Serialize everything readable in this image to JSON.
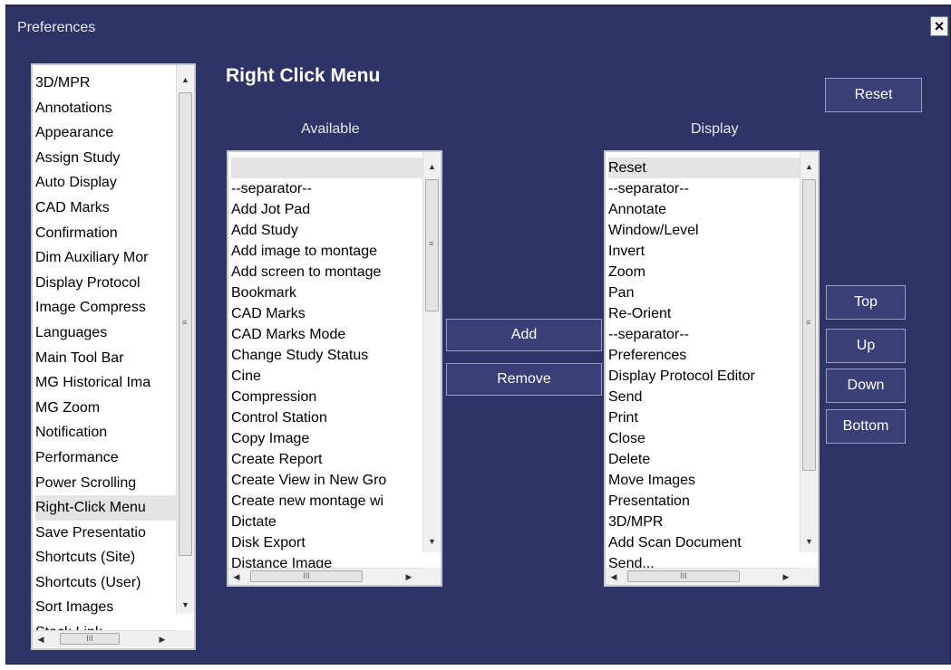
{
  "window": {
    "title": "Preferences",
    "close_label": "×"
  },
  "heading": "Right Click Menu",
  "reset_label": "Reset",
  "available_label": "Available",
  "display_label": "Display",
  "add_label": "Add",
  "remove_label": "Remove",
  "top_label": "Top",
  "up_label": "Up",
  "down_label": "Down",
  "bottom_label": "Bottom",
  "category_list": {
    "items": [
      "3D/MPR",
      "Annotations",
      "Appearance",
      "Assign Study",
      "Auto Display",
      "CAD Marks",
      "Confirmation",
      "Dim Auxiliary Mor",
      "Display Protocol",
      "Image Compress",
      "Languages",
      "Main Tool Bar",
      "MG Historical Ima",
      "MG Zoom",
      "Notification",
      "Performance",
      "Power Scrolling",
      "Right-Click Menu",
      "Save Presentatio",
      "Shortcuts (Site)",
      "Shortcuts (User)",
      "Sort Images",
      "Stack Link"
    ],
    "selected": "Right-Click Menu"
  },
  "available_list": {
    "items": [
      "",
      "--separator--",
      "Add Jot Pad",
      "Add Study",
      "Add image to montage",
      "Add screen to montage",
      "Bookmark",
      "CAD Marks",
      "CAD Marks Mode",
      "Change Study Status",
      "Cine",
      "Compression",
      "Control Station",
      "Copy Image",
      "Create Report",
      "Create View in New Gro",
      "Create new montage wi",
      "Dictate",
      "Disk Export",
      "Distance Image"
    ],
    "selected": ""
  },
  "display_list": {
    "items": [
      "Reset",
      "--separator--",
      "Annotate",
      "Window/Level",
      "Invert",
      "Zoom",
      "Pan",
      "Re-Orient",
      "--separator--",
      "Preferences",
      "Display Protocol Editor",
      "Send",
      "Print",
      "Close",
      "Delete",
      "Move Images",
      "Presentation",
      "3D/MPR",
      "Add Scan Document",
      "Send..."
    ],
    "selected": "Reset"
  },
  "scroll_glyphs": {
    "up": "▲",
    "down": "▼",
    "left": "◀",
    "right": "▶",
    "grip": "≡",
    "hgrip": "III"
  }
}
